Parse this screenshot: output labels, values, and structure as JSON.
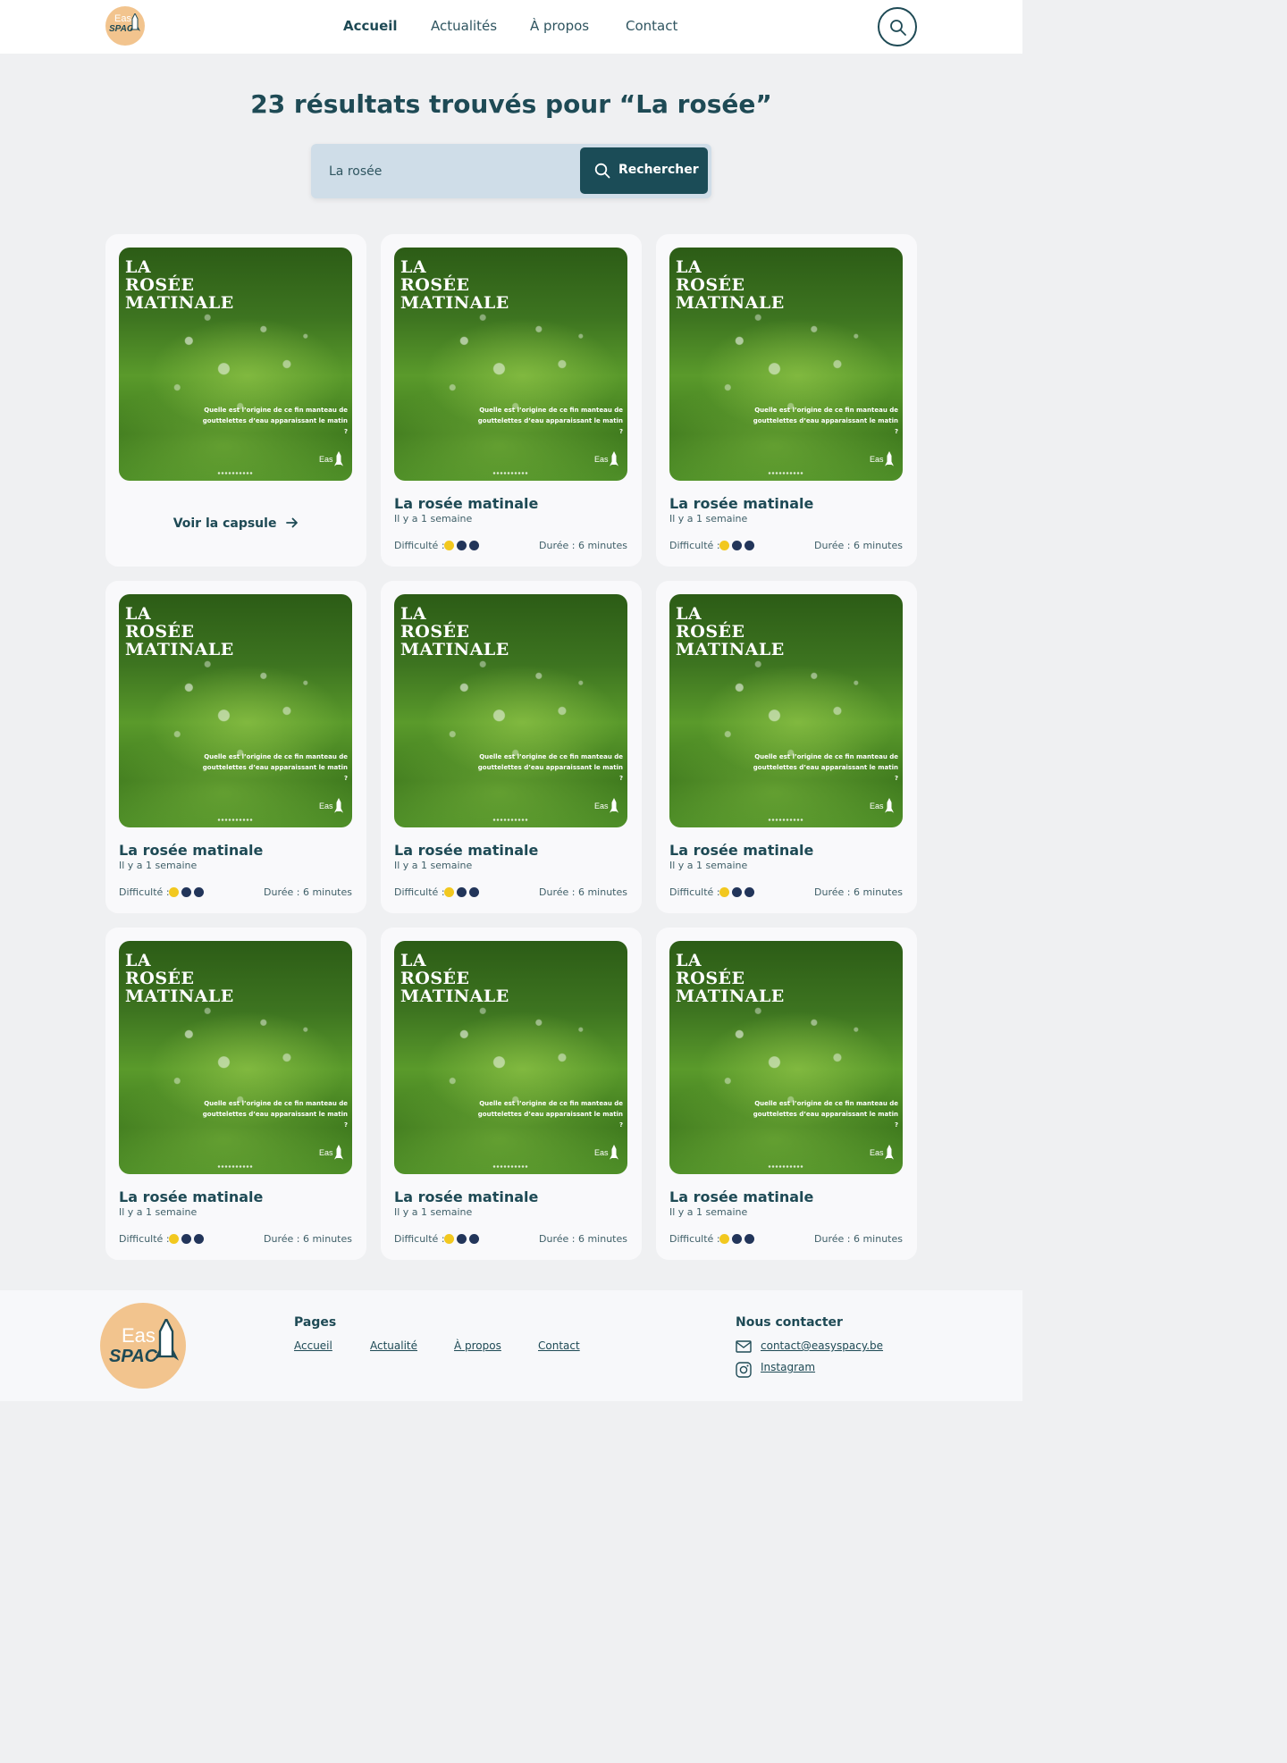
{
  "header": {
    "logo": {
      "line1": "Eas",
      "line2": "SPAC"
    },
    "nav": [
      {
        "label": "Accueil",
        "active": true
      },
      {
        "label": "Actualités",
        "active": false
      },
      {
        "label": "À propos",
        "active": false
      },
      {
        "label": "Contact",
        "active": false
      }
    ],
    "search_icon": "search-icon"
  },
  "results": {
    "count_text": "23 résultats trouvés pour ",
    "query_text": "“La rosée”"
  },
  "search": {
    "value": "La rosée",
    "button_label": "Rechercher"
  },
  "thumbnail": {
    "title_line1": "LA",
    "title_line2": "ROSÉE",
    "title_line3": "MATINALE",
    "subtitle_line1": "Quelle est l’origine de ce fin manteau de",
    "subtitle_line2": "gouttelettes d’eau apparaissant le matin ?",
    "brand": "Eas"
  },
  "cards": [
    {
      "hovered": true,
      "link_label": "Voir la capsule"
    },
    {
      "title": "La rosée matinale",
      "date": "Il y a 1 semaine",
      "difficulty_label": "Difficulté :",
      "duration": "Durée : 6 minutes"
    },
    {
      "title": "La rosée matinale",
      "date": "Il y a 1 semaine",
      "difficulty_label": "Difficulté :",
      "duration": "Durée : 6 minutes"
    },
    {
      "title": "La rosée matinale",
      "date": "Il y a 1 semaine",
      "difficulty_label": "Difficulté :",
      "duration": "Durée : 6 minutes"
    },
    {
      "title": "La rosée matinale",
      "date": "Il y a 1 semaine",
      "difficulty_label": "Difficulté :",
      "duration": "Durée : 6 minutes"
    },
    {
      "title": "La rosée matinale",
      "date": "Il y a 1 semaine",
      "difficulty_label": "Difficulté :",
      "duration": "Durée : 6 minutes"
    },
    {
      "title": "La rosée matinale",
      "date": "Il y a 1 semaine",
      "difficulty_label": "Difficulté :",
      "duration": "Durée : 6 minutes"
    },
    {
      "title": "La rosée matinale",
      "date": "Il y a 1 semaine",
      "difficulty_label": "Difficulté :",
      "duration": "Durée : 6 minutes"
    },
    {
      "title": "La rosée matinale",
      "date": "Il y a 1 semaine",
      "difficulty_label": "Difficulté :",
      "duration": "Durée : 6 minutes"
    }
  ],
  "difficulty": {
    "level": 1,
    "max": 3,
    "active_color": "#f2c81f",
    "inactive_color": "#22355a"
  },
  "footer": {
    "logo": {
      "line1": "Eas",
      "line2": "SPAC"
    },
    "pages_title": "Pages",
    "pages": [
      "Accueil",
      "Actualité",
      "À propos",
      "Contact"
    ],
    "contact_title": "Nous contacter",
    "email": "contact@easyspacy.be",
    "instagram": "Instagram"
  },
  "colors": {
    "primary": "#1b4c57",
    "background": "#eff0f2",
    "search_bg": "#cfdde8",
    "logo_bg": "#f2c48e"
  }
}
